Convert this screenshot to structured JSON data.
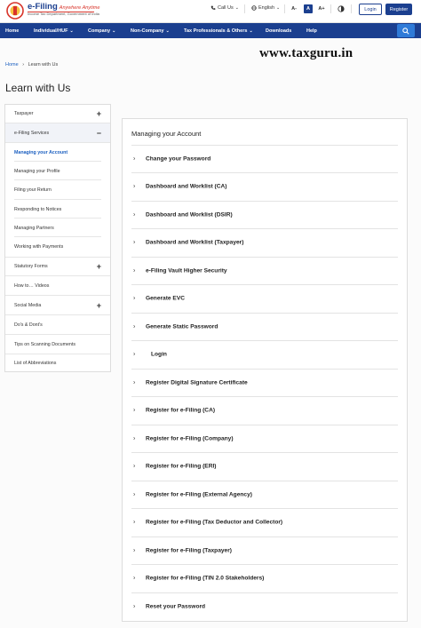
{
  "header": {
    "logo_title": "e-Filing",
    "logo_tagline": "Anywhere Anytime",
    "logo_subtitle_1": "Income Tax Department, Government of India",
    "call_us": "Call Us",
    "language": "English",
    "font_small": "A-",
    "font_normal": "A",
    "font_large": "A+",
    "login_label": "Login",
    "register_label": "Register"
  },
  "nav": {
    "items": [
      {
        "label": "Home",
        "has_dropdown": false
      },
      {
        "label": "Individual/HUF",
        "has_dropdown": true
      },
      {
        "label": "Company",
        "has_dropdown": true
      },
      {
        "label": "Non-Company",
        "has_dropdown": true
      },
      {
        "label": "Tax Professionals & Others",
        "has_dropdown": true
      },
      {
        "label": "Downloads",
        "has_dropdown": false
      },
      {
        "label": "Help",
        "has_dropdown": false
      }
    ],
    "search_icon": "search-icon"
  },
  "breadcrumb": {
    "home": "Home",
    "separator": "›",
    "current": "Learn with Us"
  },
  "watermark": "www.taxguru.in",
  "page_title": "Learn with Us",
  "sidebar": {
    "taxpayer": {
      "label": "Taxpayer",
      "toggle": "+"
    },
    "efiling_services": {
      "label": "e-Filing Services",
      "toggle": "−"
    },
    "sub_items": [
      {
        "label": "Managing your Account",
        "active": true
      },
      {
        "label": "Managing your Profile",
        "active": false
      },
      {
        "label": "Filing your Return",
        "active": false
      },
      {
        "label": "Responding to Notices",
        "active": false
      },
      {
        "label": "Managing Partners",
        "active": false
      },
      {
        "label": "Working with Payments",
        "active": false
      }
    ],
    "statutory_forms": {
      "label": "Statutory Forms",
      "toggle": "+"
    },
    "how_to_videos": {
      "label": "How to… Videos"
    },
    "social_media": {
      "label": "Social Media",
      "toggle": "+"
    },
    "dos_donts": {
      "label": "Do's & Dont's"
    },
    "tips_scanning": {
      "label": "Tips on Scanning Documents"
    },
    "abbreviations": {
      "label": "List of Abbreviations"
    }
  },
  "main": {
    "title": "Managing your Account",
    "items": [
      "Change your Password",
      "Dashboard and Worklist (CA)",
      "Dashboard and Worklist (DSIR)",
      "Dashboard and Worklist (Taxpayer)",
      "e-Filing Vault Higher Security",
      "Generate EVC",
      "Generate Static Password",
      "Login",
      "Register Digital Signature Certificate",
      "Register for e-Filing (CA)",
      "Register for e-Filing (Company)",
      "Register for e-Filing (ERI)",
      "Register for e-Filing (External Agency)",
      "Register for e-Filing (Tax Deductor and Collector)",
      "Register for e-Filing (Taxpayer)",
      "Register for e-Filing (TIN 2.0 Stakeholders)",
      "Reset your Password"
    ]
  },
  "colors": {
    "brand_blue": "#1b3f8f",
    "link_blue": "#1b5fc0",
    "search_blue": "#2f7bd8",
    "accent_red": "#d8342a"
  }
}
